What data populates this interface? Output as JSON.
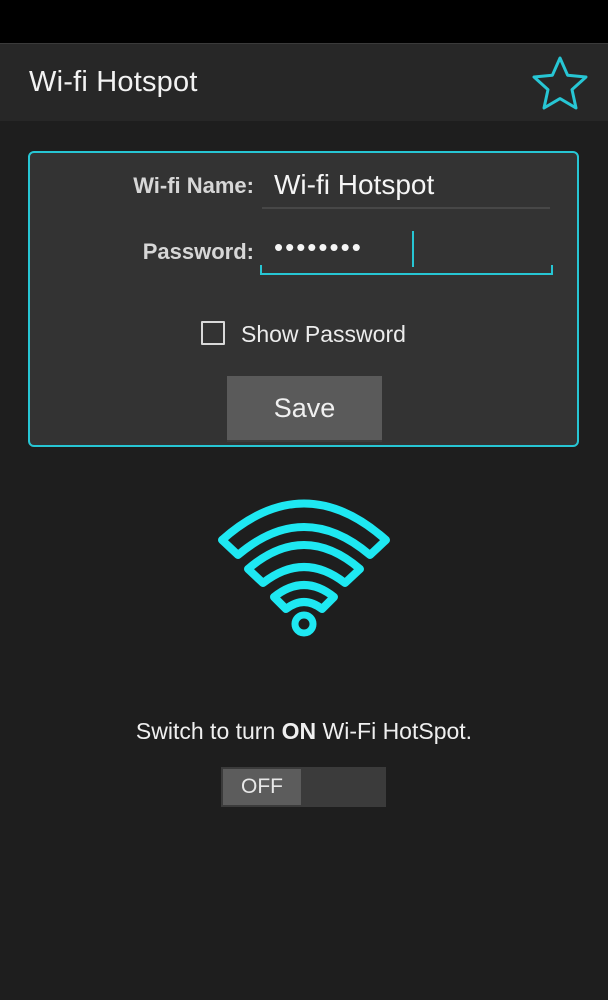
{
  "app": {
    "title": "Wi-fi Hotspot",
    "accent_color": "#27c6d4",
    "favorite_icon": "star-outline-icon"
  },
  "form": {
    "name_label": "Wi-fi Name:",
    "name_value": "Wi-fi Hotspot",
    "password_label": "Password:",
    "password_value": "••••••••",
    "show_password_label": "Show Password",
    "show_password_checked": false,
    "save_label": "Save"
  },
  "hotspot": {
    "icon": "wifi-icon",
    "switch_text_prefix": "Switch to turn ",
    "switch_text_bold": "ON",
    "switch_text_suffix": " Wi-Fi HotSpot.",
    "toggle_label": "OFF"
  }
}
